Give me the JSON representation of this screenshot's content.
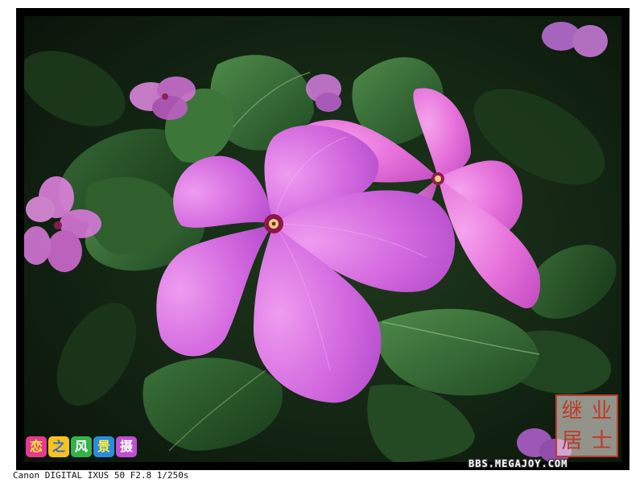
{
  "photo": {
    "subject": "pink-periwinkle-flowers"
  },
  "caption": {
    "camera_exif": "Canon DIGITAL IXUS 50 F2.8 1/250s"
  },
  "blog_badge": {
    "chars": [
      "恋",
      "之",
      "风",
      "景",
      "摄"
    ]
  },
  "seal": {
    "chars": [
      "继",
      "业",
      "居",
      "士"
    ]
  },
  "watermark": {
    "text": "BBS.MEGAJOY.COM"
  },
  "colors": {
    "frame": "#000000",
    "petal": "#d46be0",
    "petal_light": "#ef9cf0",
    "leaf": "#2f6a33",
    "seal": "#c0392b"
  }
}
